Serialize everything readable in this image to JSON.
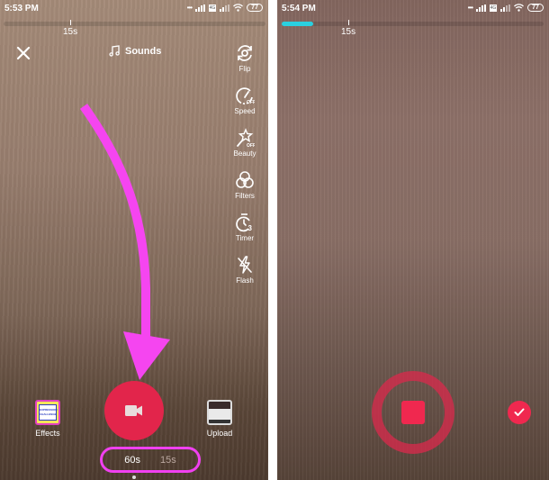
{
  "left_screen": {
    "status_bar": {
      "time": "5:53 PM",
      "battery": "77"
    },
    "progress": {
      "marker_label": "15s",
      "fill_fraction": 0
    },
    "top_bar": {
      "close_icon": "close-icon",
      "sounds_label": "Sounds"
    },
    "side_tools": [
      {
        "id": "flip",
        "label": "Flip",
        "icon": "flip-camera-icon"
      },
      {
        "id": "speed",
        "label": "Speed",
        "icon": "speed-icon",
        "badge": "OFF"
      },
      {
        "id": "beauty",
        "label": "Beauty",
        "icon": "beauty-wand-icon",
        "badge": "OFF"
      },
      {
        "id": "filters",
        "label": "Filters",
        "icon": "filters-icon"
      },
      {
        "id": "timer",
        "label": "Timer",
        "icon": "timer-icon",
        "badge": "3"
      },
      {
        "id": "flash",
        "label": "Flash",
        "icon": "flash-off-icon"
      }
    ],
    "bottom": {
      "effects_label": "Effects",
      "effects_thumb_text": "EXPRESSION CHALLENGE",
      "upload_label": "Upload",
      "record_icon": "video-camera-icon",
      "durations": [
        {
          "label": "60s",
          "active": true
        },
        {
          "label": "15s",
          "active": false
        }
      ]
    },
    "annotations": {
      "arrow_color": "#f545f0",
      "highlight_color": "#f040f0"
    }
  },
  "right_screen": {
    "status_bar": {
      "time": "5:54 PM",
      "battery": "77"
    },
    "progress": {
      "marker_label": "15s",
      "fill_fraction": 0.12,
      "fill_color": "#2ad0e0"
    },
    "bottom": {
      "stop_icon": "stop-icon",
      "confirm_icon": "checkmark-icon"
    }
  },
  "colors": {
    "record_red": "#e2254b",
    "stop_red": "#f0284f"
  }
}
